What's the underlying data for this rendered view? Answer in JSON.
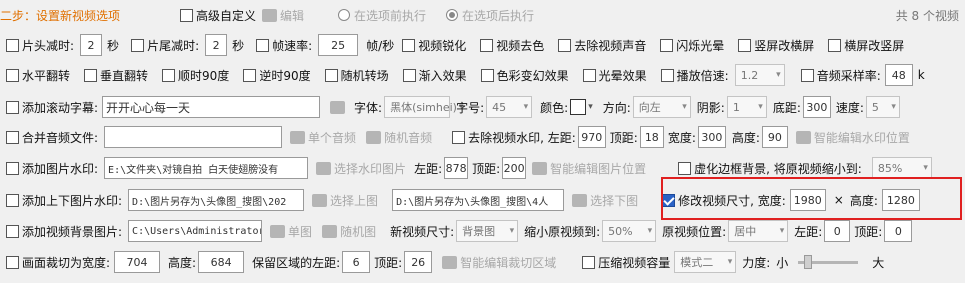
{
  "header": {
    "step_title": "二步：设置新视频选项",
    "advanced_custom": "高级自定义",
    "edit": "编辑",
    "run_before": "在选项前执行",
    "run_after": "在选项后执行",
    "total": "共 8 个视频"
  },
  "row1": {
    "head_cut": "片头减时:",
    "head_val": "2",
    "sec1": "秒",
    "tail_cut": "片尾减时:",
    "tail_val": "2",
    "sec2": "秒",
    "fps": "帧速率:",
    "fps_val": "25",
    "fps_unit": "帧/秒",
    "sharpen": "视频锐化",
    "decolor": "视频去色",
    "remove_audio": "去除视频声音",
    "flash": "闪烁光晕",
    "portrait_to_landscape": "竖屏改横屏",
    "landscape_to_portrait": "横屏改竖屏"
  },
  "row2": {
    "hflip": "水平翻转",
    "vflip": "垂直翻转",
    "cw90": "顺时90度",
    "ccw90": "逆时90度",
    "random_transition": "随机转场",
    "fade_in": "渐入效果",
    "color_change": "色彩变幻效果",
    "halo": "光晕效果",
    "speed": "播放倍速:",
    "speed_val": "1.2",
    "sample_rate": "音频采样率:",
    "sample_val": "48",
    "sample_unit": "k"
  },
  "row3": {
    "scroll_sub": "添加滚动字幕:",
    "sub_text": "开开心心每一天",
    "font": "字体:",
    "font_val": "黑体(simhei)",
    "size": "字号:",
    "size_val": "45",
    "color": "颜色:",
    "direction": "方向:",
    "direction_val": "向左",
    "shadow": "阴影:",
    "shadow_val": "1",
    "bottom": "底距:",
    "bottom_val": "300",
    "speed2": "速度:",
    "speed2_val": "5"
  },
  "row4": {
    "merge_audio": "合并音频文件:",
    "single_audio": "单个音频",
    "random_audio": "随机音频",
    "remove_watermark": "去除视频水印, 左距:",
    "wm_left": "970",
    "top": "顶距:",
    "wm_top": "18",
    "width": "宽度:",
    "wm_width": "300",
    "height": "高度:",
    "wm_height": "90",
    "smart_wm": "智能编辑水印位置"
  },
  "row5": {
    "img_watermark": "添加图片水印:",
    "img_path": "E:\\文件夹\\对镜自拍 白天使翅膀没有",
    "choose_img": "选择水印图片",
    "left": "左距:",
    "left_val": "878",
    "top": "顶距:",
    "top_val": "200",
    "smart_img": "智能编辑图片位置",
    "blur_bg": "虚化边框背景, 将原视频缩小到:",
    "blur_val": "85%"
  },
  "row6": {
    "updown_wm": "添加上下图片水印:",
    "up_path": "D:\\图片另存为\\头像图_搜图\\202",
    "choose_up": "选择上图",
    "down_path": "D:\\图片另存为\\头像图_搜图\\4人",
    "choose_down": "选择下图",
    "resize": "修改视频尺寸, 宽度:",
    "resize_w": "1980",
    "times": "×",
    "resize_h_label": "高度:",
    "resize_h": "1280"
  },
  "row7": {
    "bg_img": "添加视频背景图片:",
    "bg_path": "C:\\Users\\Administrator\\",
    "single_img": "单图",
    "random_img": "随机图",
    "new_size": "新视频尺寸:",
    "new_size_val": "背景图",
    "shrink": "缩小原视频到:",
    "shrink_val": "50%",
    "position": "原视频位置:",
    "position_val": "居中",
    "left": "左距:",
    "left_val": "0",
    "top": "顶距:",
    "top_val": "0"
  },
  "row8": {
    "crop": "画面裁切为宽度:",
    "crop_w": "704",
    "height": "高度:",
    "crop_h": "684",
    "keep_left": "保留区域的左距:",
    "keep_left_val": "6",
    "top": "顶距:",
    "top_val": "26",
    "smart_crop": "智能编辑裁切区域",
    "compress": "压缩视频容量",
    "mode_val": "模式二",
    "strength": "力度:",
    "small": "小",
    "big": "大"
  },
  "colors": {
    "accent": "#2a62c6",
    "title": "#e07000",
    "highlight": "#e02020"
  }
}
